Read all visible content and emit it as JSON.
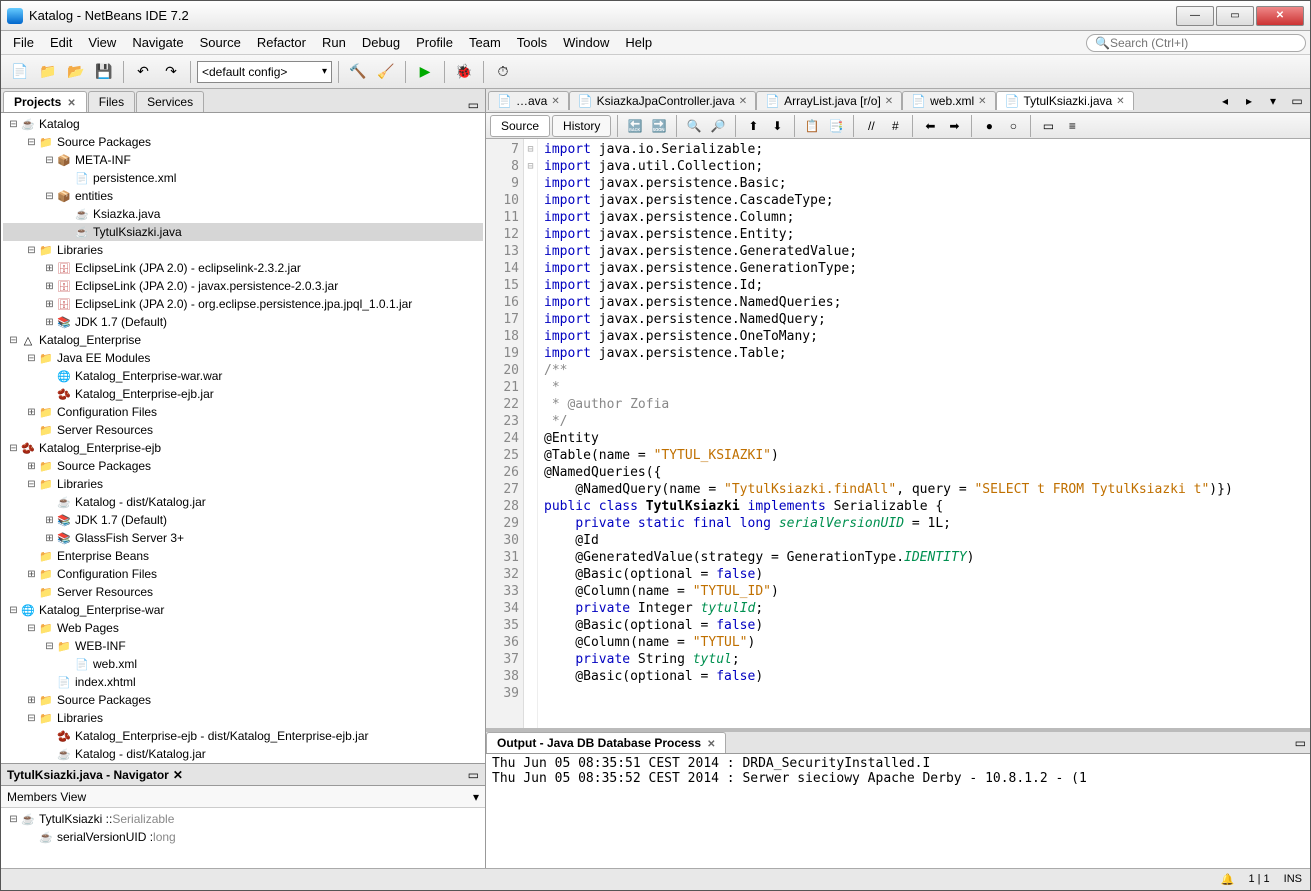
{
  "title": "Katalog - NetBeans IDE 7.2",
  "menu": [
    "File",
    "Edit",
    "View",
    "Navigate",
    "Source",
    "Refactor",
    "Run",
    "Debug",
    "Profile",
    "Team",
    "Tools",
    "Window",
    "Help"
  ],
  "search_placeholder": "Search (Ctrl+I)",
  "config_label": "<default config>",
  "left_tabs": [
    {
      "label": "Projects",
      "active": true,
      "closable": true
    },
    {
      "label": "Files",
      "active": false,
      "closable": false
    },
    {
      "label": "Services",
      "active": false,
      "closable": false
    }
  ],
  "tree": [
    {
      "d": 0,
      "ex": "-",
      "ic": "proj",
      "t": "Katalog"
    },
    {
      "d": 1,
      "ex": "-",
      "ic": "fold",
      "t": "Source Packages"
    },
    {
      "d": 2,
      "ex": "-",
      "ic": "pkg",
      "t": "META-INF"
    },
    {
      "d": 3,
      "ex": "",
      "ic": "file",
      "t": "persistence.xml"
    },
    {
      "d": 2,
      "ex": "-",
      "ic": "pkg",
      "t": "entities"
    },
    {
      "d": 3,
      "ex": "",
      "ic": "java",
      "t": "Ksiazka.java"
    },
    {
      "d": 3,
      "ex": "",
      "ic": "java",
      "t": "TytulKsiazki.java",
      "sel": true
    },
    {
      "d": 1,
      "ex": "-",
      "ic": "fold",
      "t": "Libraries"
    },
    {
      "d": 2,
      "ex": "+",
      "ic": "db",
      "t": "EclipseLink (JPA 2.0) - eclipselink-2.3.2.jar"
    },
    {
      "d": 2,
      "ex": "+",
      "ic": "db",
      "t": "EclipseLink (JPA 2.0) - javax.persistence-2.0.3.jar"
    },
    {
      "d": 2,
      "ex": "+",
      "ic": "db",
      "t": "EclipseLink (JPA 2.0) - org.eclipse.persistence.jpa.jpql_1.0.1.jar"
    },
    {
      "d": 2,
      "ex": "+",
      "ic": "jar",
      "t": "JDK 1.7 (Default)"
    },
    {
      "d": 0,
      "ex": "-",
      "ic": "ent",
      "t": "Katalog_Enterprise"
    },
    {
      "d": 1,
      "ex": "-",
      "ic": "fold",
      "t": "Java EE Modules"
    },
    {
      "d": 2,
      "ex": "",
      "ic": "war",
      "t": "Katalog_Enterprise-war.war"
    },
    {
      "d": 2,
      "ex": "",
      "ic": "ejb",
      "t": "Katalog_Enterprise-ejb.jar"
    },
    {
      "d": 1,
      "ex": "+",
      "ic": "fold",
      "t": "Configuration Files"
    },
    {
      "d": 1,
      "ex": "",
      "ic": "fold",
      "t": "Server Resources"
    },
    {
      "d": 0,
      "ex": "-",
      "ic": "ejb",
      "t": "Katalog_Enterprise-ejb"
    },
    {
      "d": 1,
      "ex": "+",
      "ic": "fold",
      "t": "Source Packages"
    },
    {
      "d": 1,
      "ex": "-",
      "ic": "fold",
      "t": "Libraries"
    },
    {
      "d": 2,
      "ex": "",
      "ic": "proj",
      "t": "Katalog - dist/Katalog.jar"
    },
    {
      "d": 2,
      "ex": "+",
      "ic": "jar",
      "t": "JDK 1.7 (Default)"
    },
    {
      "d": 2,
      "ex": "+",
      "ic": "jar",
      "t": "GlassFish Server 3+"
    },
    {
      "d": 1,
      "ex": "",
      "ic": "fold",
      "t": "Enterprise Beans"
    },
    {
      "d": 1,
      "ex": "+",
      "ic": "fold",
      "t": "Configuration Files"
    },
    {
      "d": 1,
      "ex": "",
      "ic": "fold",
      "t": "Server Resources"
    },
    {
      "d": 0,
      "ex": "-",
      "ic": "war",
      "t": "Katalog_Enterprise-war"
    },
    {
      "d": 1,
      "ex": "-",
      "ic": "fold",
      "t": "Web Pages"
    },
    {
      "d": 2,
      "ex": "-",
      "ic": "fold",
      "t": "WEB-INF"
    },
    {
      "d": 3,
      "ex": "",
      "ic": "file",
      "t": "web.xml"
    },
    {
      "d": 2,
      "ex": "",
      "ic": "file",
      "t": "index.xhtml"
    },
    {
      "d": 1,
      "ex": "+",
      "ic": "fold",
      "t": "Source Packages"
    },
    {
      "d": 1,
      "ex": "-",
      "ic": "fold",
      "t": "Libraries"
    },
    {
      "d": 2,
      "ex": "",
      "ic": "ejb",
      "t": "Katalog_Enterprise-ejb - dist/Katalog_Enterprise-ejb.jar"
    },
    {
      "d": 2,
      "ex": "",
      "ic": "proj",
      "t": "Katalog - dist/Katalog.jar"
    }
  ],
  "navigator": {
    "title": "TytulKsiazki.java - Navigator",
    "filter": "Members View",
    "items": [
      {
        "d": 0,
        "ex": "-",
        "t": "TytulKsiazki :: ",
        "hint": "Serializable"
      },
      {
        "d": 1,
        "ex": "",
        "t": "serialVersionUID : ",
        "hint": "long"
      }
    ]
  },
  "editor_tabs": [
    {
      "label": "…ava",
      "active": false
    },
    {
      "label": "KsiazkaJpaController.java",
      "active": false
    },
    {
      "label": "ArrayList.java [r/o]",
      "active": false
    },
    {
      "label": "web.xml",
      "active": false
    },
    {
      "label": "TytulKsiazki.java",
      "active": true
    }
  ],
  "subtabs": [
    {
      "label": "Source",
      "active": true
    },
    {
      "label": "History",
      "active": false
    }
  ],
  "code_start": 7,
  "code": [
    [
      [
        "kw",
        "import"
      ],
      [
        "",
        " java.io.Serializable;"
      ]
    ],
    [
      [
        "kw",
        "import"
      ],
      [
        "",
        " java.util.Collection;"
      ]
    ],
    [
      [
        "kw",
        "import"
      ],
      [
        "",
        " javax.persistence.Basic;"
      ]
    ],
    [
      [
        "kw",
        "import"
      ],
      [
        "",
        " javax.persistence.CascadeType;"
      ]
    ],
    [
      [
        "kw",
        "import"
      ],
      [
        "",
        " javax.persistence.Column;"
      ]
    ],
    [
      [
        "kw",
        "import"
      ],
      [
        "",
        " javax.persistence.Entity;"
      ]
    ],
    [
      [
        "kw",
        "import"
      ],
      [
        "",
        " javax.persistence.GeneratedValue;"
      ]
    ],
    [
      [
        "kw",
        "import"
      ],
      [
        "",
        " javax.persistence.GenerationType;"
      ]
    ],
    [
      [
        "kw",
        "import"
      ],
      [
        "",
        " javax.persistence.Id;"
      ]
    ],
    [
      [
        "kw",
        "import"
      ],
      [
        "",
        " javax.persistence.NamedQueries;"
      ]
    ],
    [
      [
        "kw",
        "import"
      ],
      [
        "",
        " javax.persistence.NamedQuery;"
      ]
    ],
    [
      [
        "kw",
        "import"
      ],
      [
        "",
        " javax.persistence.OneToMany;"
      ]
    ],
    [
      [
        "kw",
        "import"
      ],
      [
        "",
        " javax.persistence.Table;"
      ]
    ],
    [
      [
        "",
        ""
      ]
    ],
    [
      [
        "jd",
        "/**"
      ]
    ],
    [
      [
        "jd",
        " *"
      ]
    ],
    [
      [
        "jd",
        " * @author Zofia"
      ]
    ],
    [
      [
        "jd",
        " */"
      ]
    ],
    [
      [
        "",
        "@Entity"
      ]
    ],
    [
      [
        "",
        "@Table(name = "
      ],
      [
        "str",
        "\"TYTUL_KSIAZKI\""
      ],
      [
        "",
        ")"
      ]
    ],
    [
      [
        "",
        "@NamedQueries({"
      ]
    ],
    [
      [
        "",
        "    @NamedQuery(name = "
      ],
      [
        "str",
        "\"TytulKsiazki.findAll\""
      ],
      [
        "",
        ", query = "
      ],
      [
        "str",
        "\"SELECT t FROM TytulKsiazki t\""
      ],
      [
        "",
        ")})"
      ]
    ],
    [
      [
        "kw",
        "public class"
      ],
      [
        "",
        " "
      ],
      [
        "b",
        "TytulKsiazki"
      ],
      [
        "",
        " "
      ],
      [
        "kw",
        "implements"
      ],
      [
        "",
        " Serializable {"
      ]
    ],
    [
      [
        "",
        "    "
      ],
      [
        "kw",
        "private static final long"
      ],
      [
        "",
        " "
      ],
      [
        "fld",
        "serialVersionUID"
      ],
      [
        "",
        " = 1L;"
      ]
    ],
    [
      [
        "",
        "    @Id"
      ]
    ],
    [
      [
        "",
        "    @GeneratedValue(strategy = GenerationType."
      ],
      [
        "fld",
        "IDENTITY"
      ],
      [
        "",
        ")"
      ]
    ],
    [
      [
        "",
        "    @Basic(optional = "
      ],
      [
        "kw",
        "false"
      ],
      [
        "",
        ")"
      ]
    ],
    [
      [
        "",
        "    @Column(name = "
      ],
      [
        "str",
        "\"TYTUL_ID\""
      ],
      [
        "",
        ")"
      ]
    ],
    [
      [
        "",
        "    "
      ],
      [
        "kw",
        "private"
      ],
      [
        "",
        " Integer "
      ],
      [
        "fld",
        "tytulId"
      ],
      [
        "",
        ";"
      ]
    ],
    [
      [
        "",
        "    @Basic(optional = "
      ],
      [
        "kw",
        "false"
      ],
      [
        "",
        ")"
      ]
    ],
    [
      [
        "",
        "    @Column(name = "
      ],
      [
        "str",
        "\"TYTUL\""
      ],
      [
        "",
        ")"
      ]
    ],
    [
      [
        "",
        "    "
      ],
      [
        "kw",
        "private"
      ],
      [
        "",
        " String "
      ],
      [
        "fld",
        "tytul"
      ],
      [
        "",
        ";"
      ]
    ],
    [
      [
        "",
        "    @Basic(optional = "
      ],
      [
        "kw",
        "false"
      ],
      [
        "",
        ")"
      ]
    ]
  ],
  "output": {
    "title": "Output - Java DB Database Process",
    "lines": [
      "Thu Jun 05 08:35:51 CEST 2014 : DRDA_SecurityInstalled.I",
      "Thu Jun 05 08:35:52 CEST 2014 : Serwer sieciowy Apache Derby - 10.8.1.2 - (1"
    ]
  },
  "status": {
    "pos": "1 | 1",
    "mode": "INS"
  }
}
